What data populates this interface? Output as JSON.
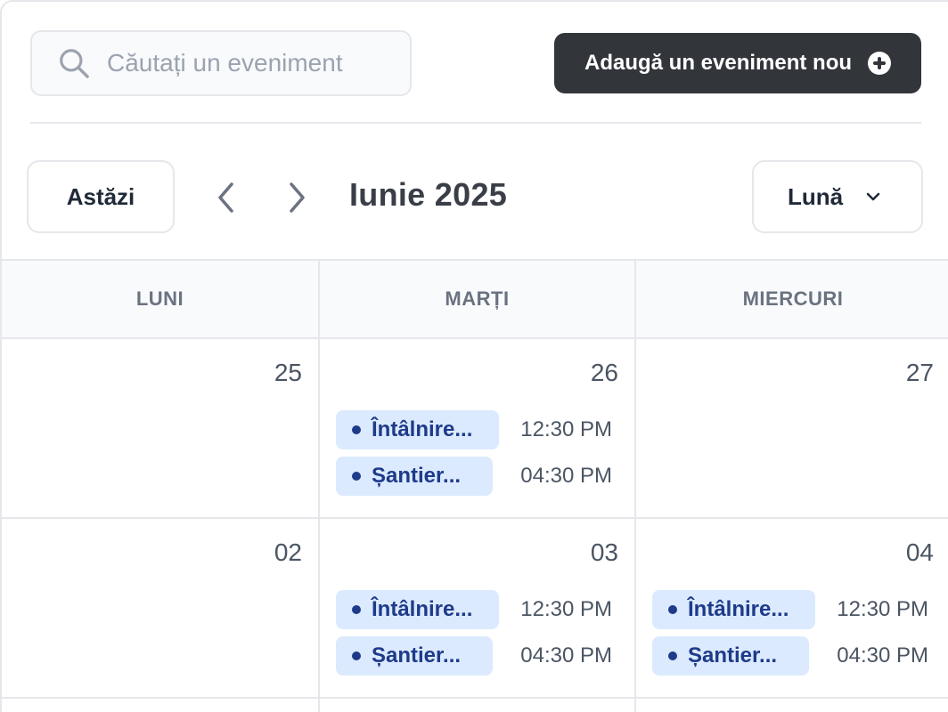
{
  "search": {
    "placeholder": "Căutați un eveniment",
    "value": ""
  },
  "add_button": {
    "label": "Adaugă un eveniment nou"
  },
  "toolbar": {
    "today_label": "Astăzi",
    "month_title": "Iunie 2025",
    "view_label": "Lună"
  },
  "weekdays": [
    "LUNI",
    "MARȚI",
    "MIERCURI"
  ],
  "weeks": [
    {
      "days": [
        {
          "num": "25",
          "events": []
        },
        {
          "num": "26",
          "events": [
            {
              "name": "Întâlnire...",
              "time": "12:30 PM"
            },
            {
              "name": "Șantier...",
              "time": "04:30 PM"
            }
          ]
        },
        {
          "num": "27",
          "events": []
        }
      ]
    },
    {
      "days": [
        {
          "num": "02",
          "events": []
        },
        {
          "num": "03",
          "events": [
            {
              "name": "Întâlnire...",
              "time": "12:30 PM"
            },
            {
              "name": "Șantier...",
              "time": "04:30 PM"
            }
          ]
        },
        {
          "num": "04",
          "events": [
            {
              "name": "Întâlnire...",
              "time": "12:30 PM"
            },
            {
              "name": "Șantier...",
              "time": "04:30 PM"
            }
          ]
        }
      ]
    }
  ],
  "colors": {
    "primary_button": "#32363b",
    "event_bg": "#dbeafe",
    "event_text": "#1e3a8a"
  }
}
